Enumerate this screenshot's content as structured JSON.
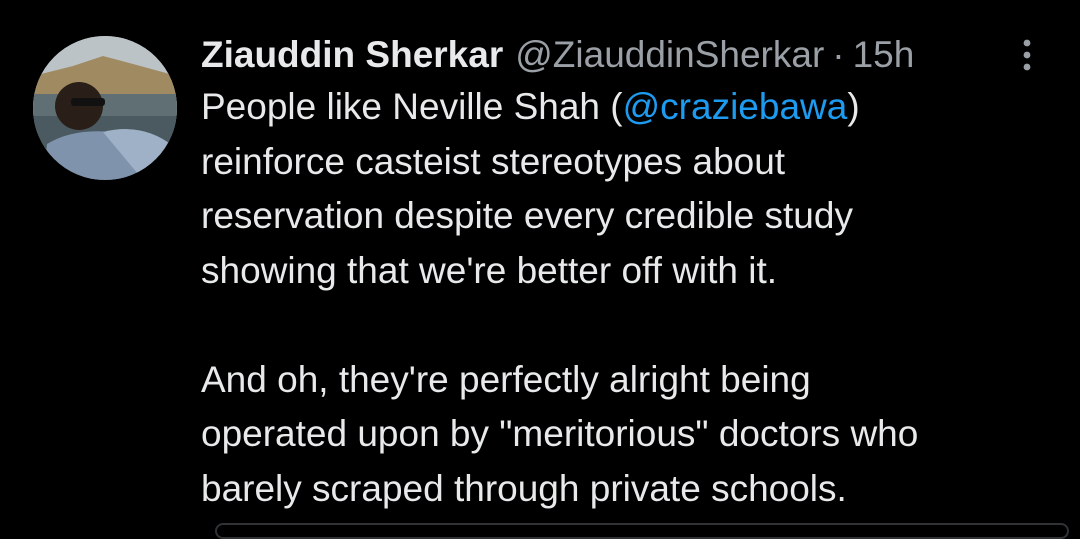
{
  "tweet": {
    "author_name": "Ziauddin Sherkar",
    "author_handle": "@ZiauddinSherkar",
    "separator": "·",
    "time": "15h",
    "more_icon": "more-vertical-icon",
    "avatar": "avatar",
    "text": {
      "l1_pre": "People like Neville Shah (",
      "l1_mention": "@craziebawa",
      "l1_post": ")",
      "l2": "reinforce casteist stereotypes about",
      "l3": "reservation despite every credible study",
      "l4": "showing that we're better off with it.",
      "l5": "And oh, they're perfectly alright being",
      "l6": "operated upon by \"meritorious\" doctors who",
      "l7": "barely scraped through private schools."
    }
  },
  "colors": {
    "background": "#000000",
    "text": "#e7e9ea",
    "secondary": "#9aa0a6",
    "link": "#1d9bf0"
  }
}
